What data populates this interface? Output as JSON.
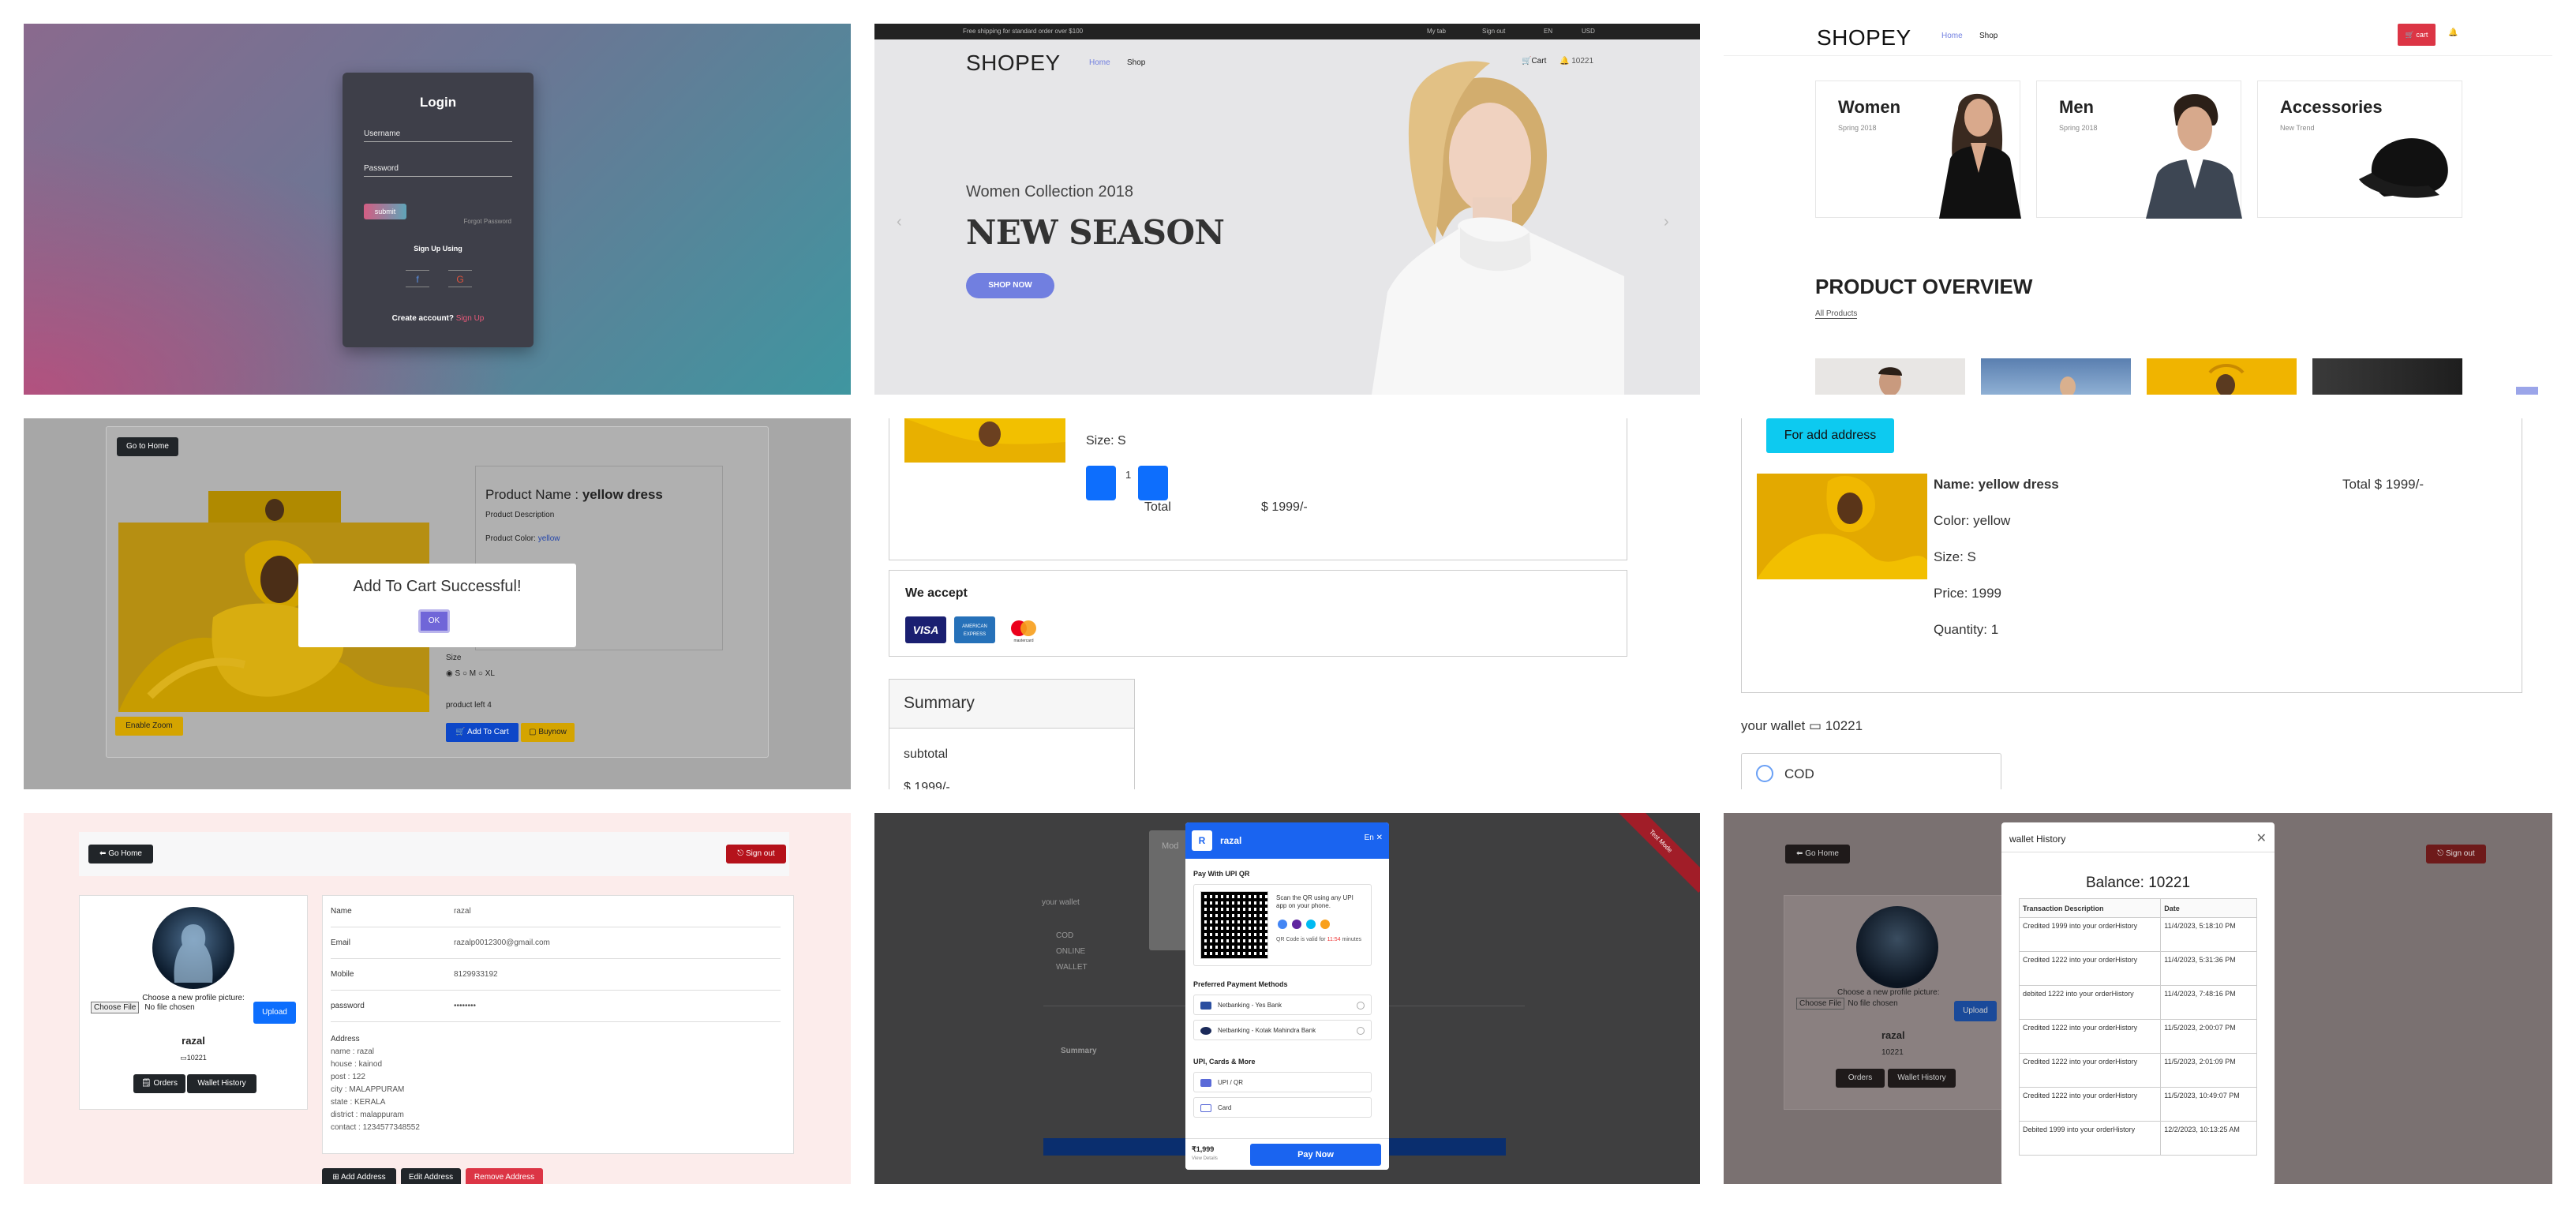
{
  "login": {
    "title": "Login",
    "username_placeholder": "Username",
    "password_placeholder": "Password",
    "submit": "submit",
    "forgot": "Forgot Password",
    "signup_using": "Sign Up Using",
    "facebook_glyph": "f",
    "google_glyph": "G",
    "create_account": "Create account?",
    "sign_up_link": "Sign Up",
    "colors": {
      "gradient_start": "#8a6a8e",
      "gradient_end": "#3f96a0",
      "pink": "#e85a7a"
    }
  },
  "home": {
    "topbar_text": "Free shipping for standard order over $100",
    "topbar_right": [
      "My tab",
      "Sign out",
      "EN",
      "USD"
    ],
    "logo": "SHOPEY",
    "nav": [
      "Home",
      "Shop"
    ],
    "cart_label": "Cart",
    "wallet_label": "10221",
    "hero_subtitle": "Women Collection 2018",
    "hero_title": "NEW SEASON",
    "hero_button": "SHOP NOW",
    "accent": "#717fe0"
  },
  "shop": {
    "logo": "SHOPEY",
    "nav": [
      "Home",
      "Shop"
    ],
    "cart_button": "cart",
    "categories": [
      {
        "title": "Women",
        "sub": "Spring 2018"
      },
      {
        "title": "Men",
        "sub": "Spring 2018"
      },
      {
        "title": "Accessories",
        "sub": "New Trend"
      }
    ],
    "overview_title": "PRODUCT OVERVIEW",
    "all_products": "All Products"
  },
  "product": {
    "go_home": "Go to Home",
    "name_label": "Product Name : ",
    "name_value": "yellow dress",
    "description_label": "Product Description",
    "color_label": "Product Color: ",
    "color_value": "yellow",
    "alert_text": "Add To Cart Successful!",
    "ok": "OK",
    "size_label": "Size",
    "sizes": [
      "S",
      "M",
      "XL"
    ],
    "stock_left": "product left 4",
    "add_to_cart": "Add To Cart",
    "buy_now": "Buynow",
    "enable_zoom": "Enable Zoom"
  },
  "cart": {
    "size": "Size: S",
    "quantity": "1",
    "total_label": "Total",
    "total_value": "$ 1999/-",
    "we_accept": "We accept",
    "cards": [
      "VISA",
      "AMERICAN EXPRESS",
      "mastercard"
    ],
    "summary": "Summary",
    "subtotal": "subtotal",
    "subtotal_value": "$ 1999/-"
  },
  "checkout": {
    "for_add_address": "For add address",
    "name": "Name: yellow dress",
    "color": "Color: yellow",
    "size": "Size: S",
    "price": "Price: 1999",
    "quantity": "Quantity: 1",
    "total": "Total $ 1999/-",
    "wallet_label": "your wallet",
    "wallet_value": "10221",
    "payment_option": "COD"
  },
  "profile": {
    "go_home": "Go Home",
    "sign_out": "Sign out",
    "choose_picture": "Choose a new profile picture:",
    "choose_file": "Choose File",
    "no_file": "No file chosen",
    "upload": "Upload",
    "username": "razal",
    "wallet": "10221",
    "orders": "Orders",
    "wallet_history": "Wallet History",
    "fields": [
      {
        "key": "Name",
        "value": "razal"
      },
      {
        "key": "Email",
        "value": "razalp0012300@gmail.com"
      },
      {
        "key": "Mobile",
        "value": "8129933192"
      },
      {
        "key": "password",
        "value": "••••••••"
      }
    ],
    "address_title": "Address",
    "address_lines": [
      "name : razal",
      "house : kainod",
      "post : 122",
      "city : MALAPPURAM",
      "state : KERALA",
      "district : malappuram",
      "contact : 1234577348552"
    ],
    "add_address": "Add Address",
    "edit_address": "Edit Address",
    "remove_address": "Remove Address"
  },
  "payment": {
    "merchant": "razal",
    "merchant_initial": "R",
    "test_mode": "Test Mode",
    "lang": "En",
    "pay_with_upi": "Pay With UPI QR",
    "scan_text": "Scan the QR using any UPI app on your phone.",
    "qr_valid_prefix": "QR Code is valid for",
    "qr_valid_time": "11:54",
    "qr_valid_suffix": "minutes",
    "preferred": "Preferred Payment Methods",
    "methods": [
      "Netbanking - Yes Bank",
      "Netbanking - Kotak Mahindra Bank"
    ],
    "upi_cards": "UPI, Cards & More",
    "options": [
      "UPI / QR",
      "Card"
    ],
    "amount": "₹1,999",
    "view_details": "View Details",
    "pay_now": "Pay Now",
    "bg_modal_title": "Mod",
    "bg_options": [
      "COD",
      "ONLINE",
      "WALLET"
    ],
    "bg_wallet": "your wallet",
    "bg_summary": "Summary"
  },
  "wallet_history": {
    "bg_go_home": "Go Home",
    "bg_sign_out": "Sign out",
    "bg_choose_file": "Choose File",
    "bg_no_file": "No file chosen",
    "bg_upload": "Upload",
    "bg_username": "razal",
    "bg_wallet": "10221",
    "bg_orders": "Orders",
    "bg_wallet_history": "Wallet History",
    "bg_choose_picture": "Choose a new profile picture:",
    "title": "wallet History",
    "balance": "Balance: 10221",
    "columns": [
      "Transaction Description",
      "Date"
    ],
    "rows": [
      [
        "Credited 1999 into your orderHistory",
        "11/4/2023, 5:18:10 PM"
      ],
      [
        "Credited 1222 into your orderHistory",
        "11/4/2023, 5:31:36 PM"
      ],
      [
        "debited 1222 into your orderHistory",
        "11/4/2023, 7:48:16 PM"
      ],
      [
        "Credited 1222 into your orderHistory",
        "11/5/2023, 2:00:07 PM"
      ],
      [
        "Credited 1222 into your orderHistory",
        "11/5/2023, 2:01:09 PM"
      ],
      [
        "Credited 1222 into your orderHistory",
        "11/5/2023, 10:49:07 PM"
      ],
      [
        "Debited 1999 into your orderHistory",
        "12/2/2023, 10:13:25 AM"
      ]
    ]
  }
}
